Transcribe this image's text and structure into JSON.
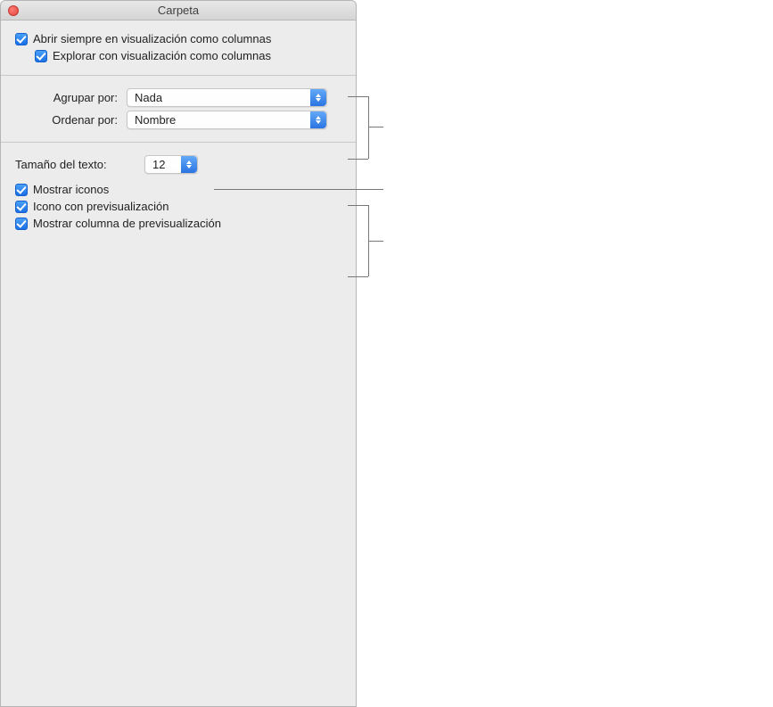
{
  "window": {
    "title": "Carpeta"
  },
  "top": {
    "always_open_label": "Abrir siempre en visualización como columnas",
    "browse_label": "Explorar con visualización como columnas"
  },
  "sorting": {
    "group_by_label": "Agrupar por:",
    "group_by_value": "Nada",
    "sort_by_label": "Ordenar por:",
    "sort_by_value": "Nombre"
  },
  "text_size": {
    "label": "Tamaño del texto:",
    "value": "12"
  },
  "bottom": {
    "show_icons_label": "Mostrar iconos",
    "icon_preview_label": "Icono con previsualización",
    "show_preview_col_label": "Mostrar columna de previsualización"
  }
}
